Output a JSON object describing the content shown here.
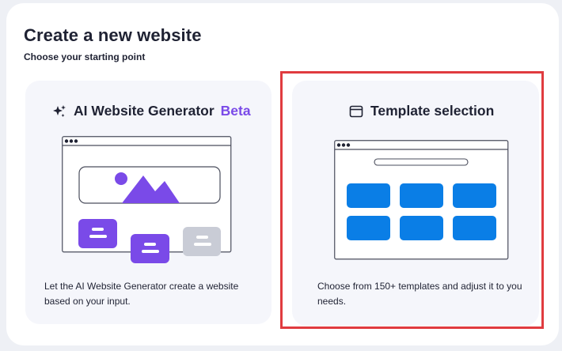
{
  "page": {
    "title": "Create a new website",
    "subtitle": "Choose your starting point"
  },
  "options": [
    {
      "id": "ai-generator",
      "label": "AI Website Generator",
      "badge": "Beta",
      "description": "Let the AI Website Generator create a website based on your input.",
      "icon": "sparkles-icon",
      "selected": false
    },
    {
      "id": "template-selection",
      "label": "Template selection",
      "description": "Choose from 150+ templates and adjust it to you needs.",
      "icon": "browser-window-icon",
      "selected": true
    }
  ],
  "colors": {
    "background": "#eef0f5",
    "panel": "#ffffff",
    "card": "#f5f6fb",
    "text": "#1f2233",
    "accent_purple": "#7a4ae8",
    "accent_blue": "#0a7ee6",
    "muted_block": "#c9ccd6",
    "selection_border": "#e03b3f"
  }
}
